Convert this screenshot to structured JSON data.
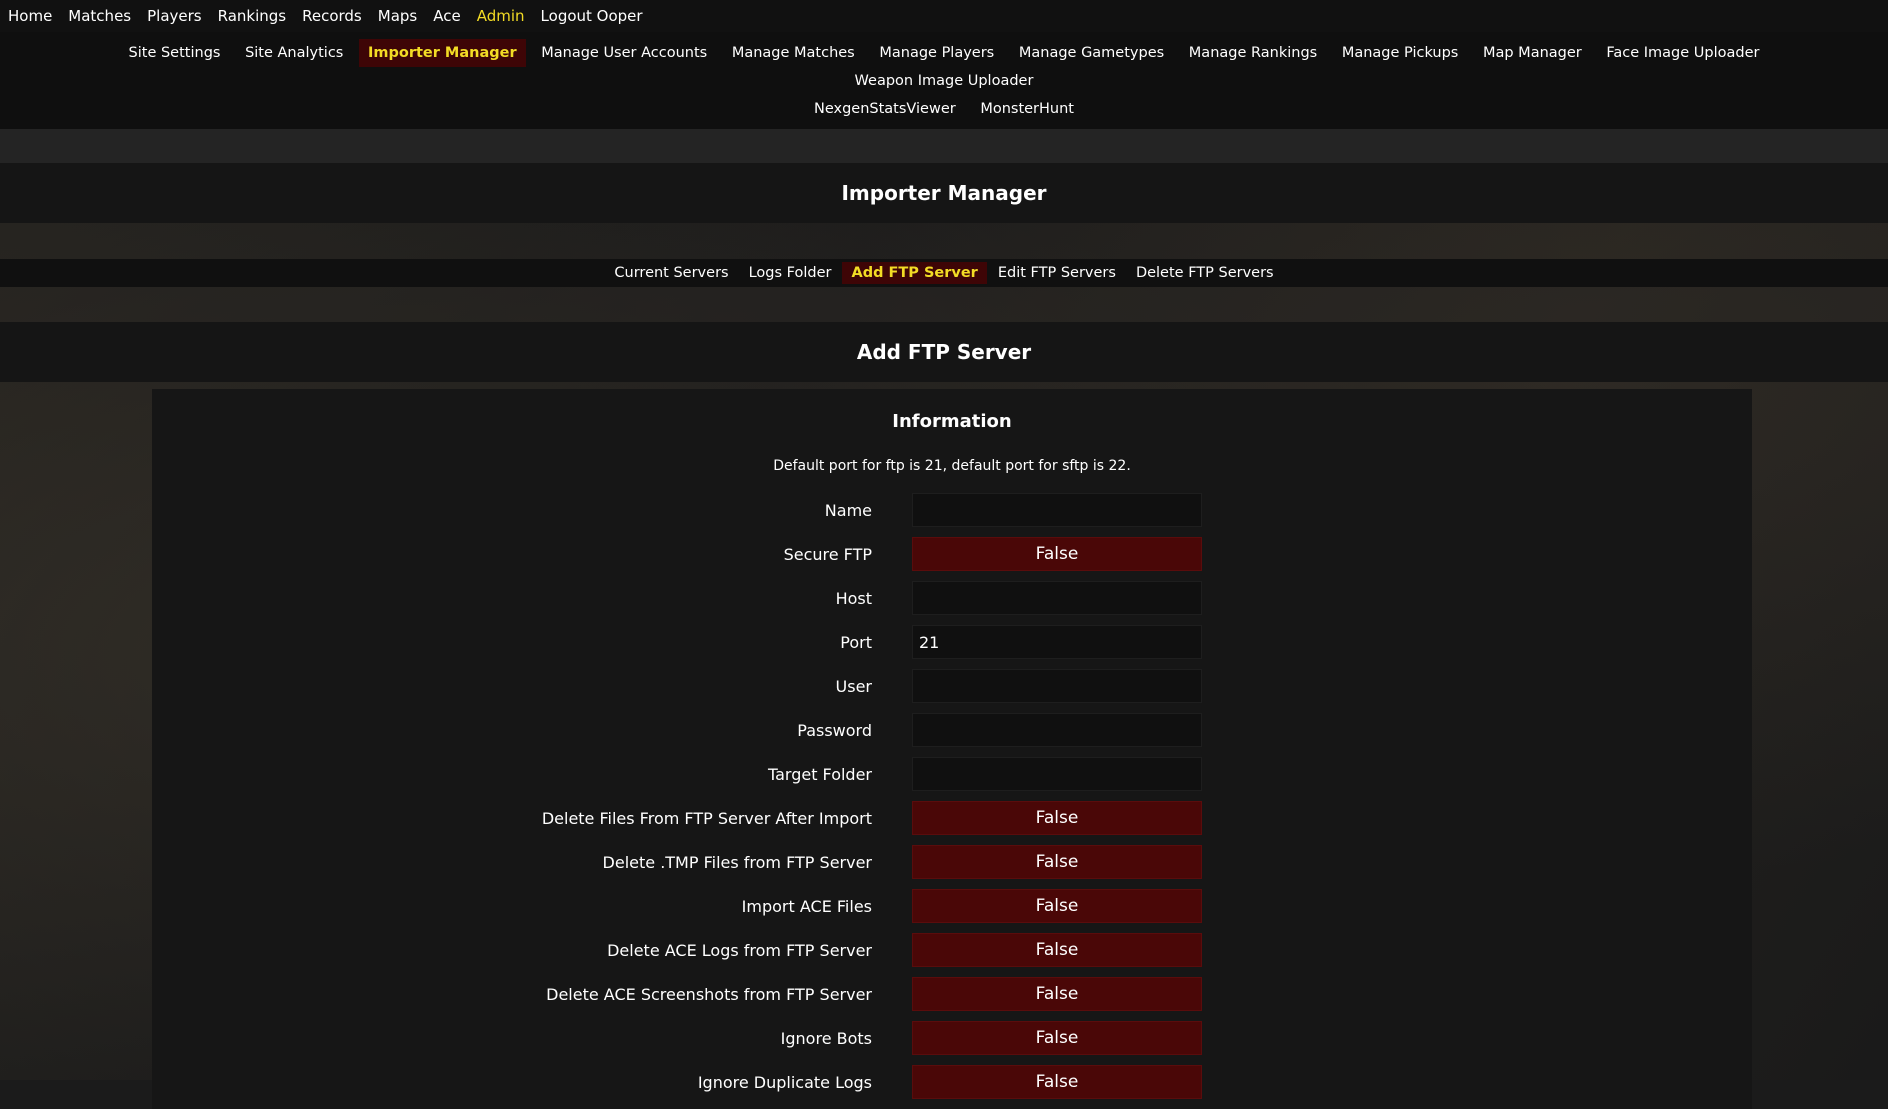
{
  "topnav": {
    "items": [
      "Home",
      "Matches",
      "Players",
      "Rankings",
      "Records",
      "Maps",
      "Ace",
      "Admin",
      "Logout Ooper"
    ],
    "active": "Admin"
  },
  "adminnav": {
    "items": [
      "Site Settings",
      "Site Analytics",
      "Importer Manager",
      "Manage User Accounts",
      "Manage Matches",
      "Manage Players",
      "Manage Gametypes",
      "Manage Rankings",
      "Manage Pickups",
      "Map Manager",
      "Face Image Uploader",
      "Weapon Image Uploader",
      "NexgenStatsViewer",
      "MonsterHunt"
    ],
    "active": "Importer Manager"
  },
  "page_title": "Importer Manager",
  "subnav": {
    "items": [
      "Current Servers",
      "Logs Folder",
      "Add FTP Server",
      "Edit FTP Servers",
      "Delete FTP Servers"
    ],
    "active": "Add FTP Server"
  },
  "section_title": "Add FTP Server",
  "panel": {
    "title": "Information",
    "info": "Default port for ftp is 21, default port for sftp is 22."
  },
  "form": {
    "name": {
      "label": "Name",
      "value": ""
    },
    "secure_ftp": {
      "label": "Secure FTP",
      "value": "False"
    },
    "host": {
      "label": "Host",
      "value": ""
    },
    "port": {
      "label": "Port",
      "value": "21"
    },
    "user": {
      "label": "User",
      "value": ""
    },
    "password": {
      "label": "Password",
      "value": ""
    },
    "target_folder": {
      "label": "Target Folder",
      "value": ""
    },
    "delete_files": {
      "label": "Delete Files From FTP Server After Import",
      "value": "False"
    },
    "delete_tmp": {
      "label": "Delete .TMP Files from FTP Server",
      "value": "False"
    },
    "import_ace": {
      "label": "Import ACE Files",
      "value": "False"
    },
    "delete_ace_logs": {
      "label": "Delete ACE Logs from FTP Server",
      "value": "False"
    },
    "delete_ace_screenshots": {
      "label": "Delete ACE Screenshots from FTP Server",
      "value": "False"
    },
    "ignore_bots": {
      "label": "Ignore Bots",
      "value": "False"
    },
    "ignore_duplicate_logs": {
      "label": "Ignore Duplicate Logs",
      "value": "False"
    }
  },
  "colors": {
    "accent": "#f3dc25",
    "active_bg": "#3e0506",
    "toggle_false": "#4a0707"
  }
}
